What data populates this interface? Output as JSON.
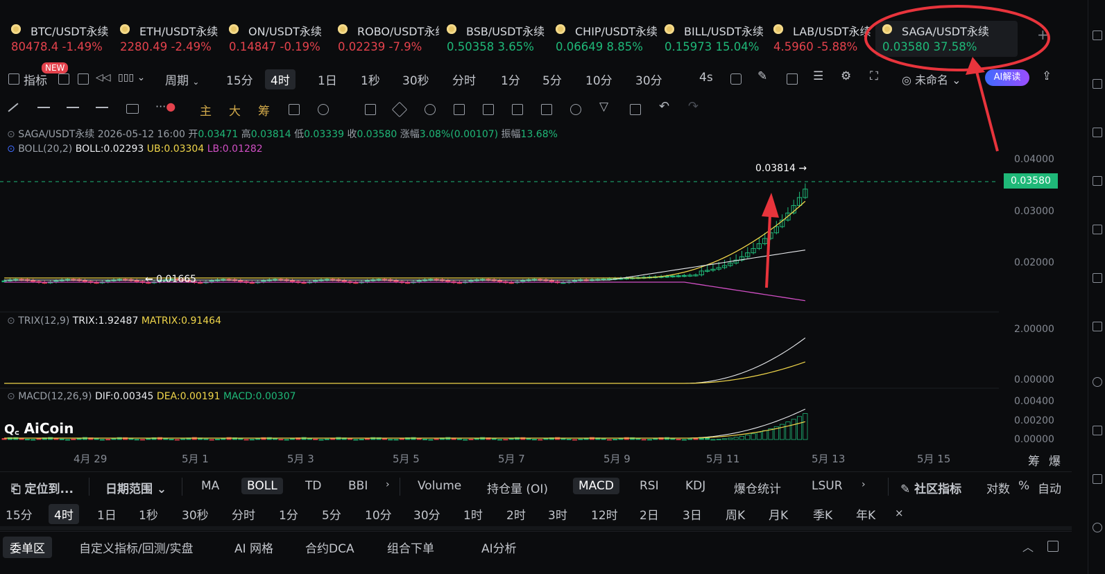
{
  "tickers": [
    {
      "symbol": "BTC/USDT永续",
      "price": "80478.4",
      "change": "-1.49%",
      "dir": "dn"
    },
    {
      "symbol": "ETH/USDT永续",
      "price": "2280.49",
      "change": "-2.49%",
      "dir": "dn"
    },
    {
      "symbol": "ON/USDT永续",
      "price": "0.14847",
      "change": "-0.19%",
      "dir": "dn"
    },
    {
      "symbol": "ROBO/USDT永续",
      "price": "0.02239",
      "change": "-7.9%",
      "dir": "dn"
    },
    {
      "symbol": "BSB/USDT永续",
      "price": "0.50358",
      "change": "3.65%",
      "dir": "up"
    },
    {
      "symbol": "CHIP/USDT永续",
      "price": "0.06649",
      "change": "8.85%",
      "dir": "up"
    },
    {
      "symbol": "BILL/USDT永续",
      "price": "0.15973",
      "change": "15.04%",
      "dir": "up"
    },
    {
      "symbol": "LAB/USDT永续",
      "price": "4.5960",
      "change": "-5.88%",
      "dir": "dn"
    },
    {
      "symbol": "SAGA/USDT永续",
      "price": "0.03580",
      "change": "37.58%",
      "dir": "up"
    }
  ],
  "toolbar": {
    "indicator": "指标",
    "new_badge": "NEW",
    "period": "周期",
    "intervals": [
      "15分",
      "4时",
      "1日",
      "1秒",
      "30秒",
      "分时",
      "1分",
      "5分",
      "10分",
      "30分"
    ],
    "selected_interval": "4时",
    "speed": "4s",
    "layout_name": "未命名",
    "ai_btn": "AI解读"
  },
  "draw_tools": {
    "zhu": "主",
    "da": "大",
    "chou": "筹"
  },
  "ohlc": {
    "symbol": "SAGA/USDT永续",
    "time": "2026-05-12 16:00",
    "open_label": "开",
    "open": "0.03471",
    "high_label": "高",
    "high": "0.03814",
    "low_label": "低",
    "low": "0.03339",
    "close_label": "收",
    "close": "0.03580",
    "chg_label": "涨幅",
    "chg": "3.08%(0.00107)",
    "amp_label": "振幅",
    "amp": "13.68%"
  },
  "boll": {
    "name": "BOLL(20,2)",
    "mid": "BOLL:0.02293",
    "ub": "UB:0.03304",
    "lb": "LB:0.01282"
  },
  "trix": {
    "name": "TRIX(12,9)",
    "trix": "TRIX:1.92487",
    "matrix": "MATRIX:0.91464"
  },
  "macd": {
    "name": "MACD(12,26,9)",
    "dif": "DIF:0.00345",
    "dea": "DEA:0.00191",
    "macd": "MACD:0.00307"
  },
  "price_axis": {
    "main": [
      "0.04000",
      "0.03000",
      "0.02000"
    ],
    "trix": [
      "2.00000",
      "0.00000"
    ],
    "macd": [
      "0.00400",
      "0.00200",
      "0.00000"
    ]
  },
  "current_price": "0.03580",
  "high_marker": "0.03814 →",
  "low_marker": "← 0.01665",
  "dates": [
    "4月 29",
    "5月 1",
    "5月 3",
    "5月 5",
    "5月 7",
    "5月 9",
    "5月 11",
    "5月 13",
    "5月 15"
  ],
  "bottom_right_labels": {
    "chou": "筹",
    "bao": "爆"
  },
  "logo": "AiCoin",
  "indicator_bar": {
    "locate": "定位到...",
    "date_range": "日期范围",
    "main": [
      "MA",
      "BOLL",
      "TD",
      "BBI"
    ],
    "selected_main": "BOLL",
    "sub": [
      "Volume",
      "持仓量 (OI)",
      "MACD",
      "RSI",
      "KDJ",
      "爆仓统计",
      "LSUR"
    ],
    "selected_sub": "MACD",
    "community": "社区指标",
    "log": "对数",
    "pct": "%",
    "auto": "自动"
  },
  "interval_bar": [
    "15分",
    "4时",
    "1日",
    "1秒",
    "30秒",
    "分时",
    "1分",
    "5分",
    "10分",
    "30分",
    "1时",
    "2时",
    "3时",
    "12时",
    "2日",
    "3日",
    "周K",
    "月K",
    "季K",
    "年K"
  ],
  "selected_interval_bar": "4时",
  "bottom_tabs": [
    "委单区",
    "自定义指标/回测/实盘",
    "AI 网格",
    "合约DCA",
    "组合下单",
    "AI分析"
  ],
  "selected_bottom_tab": "委单区"
}
